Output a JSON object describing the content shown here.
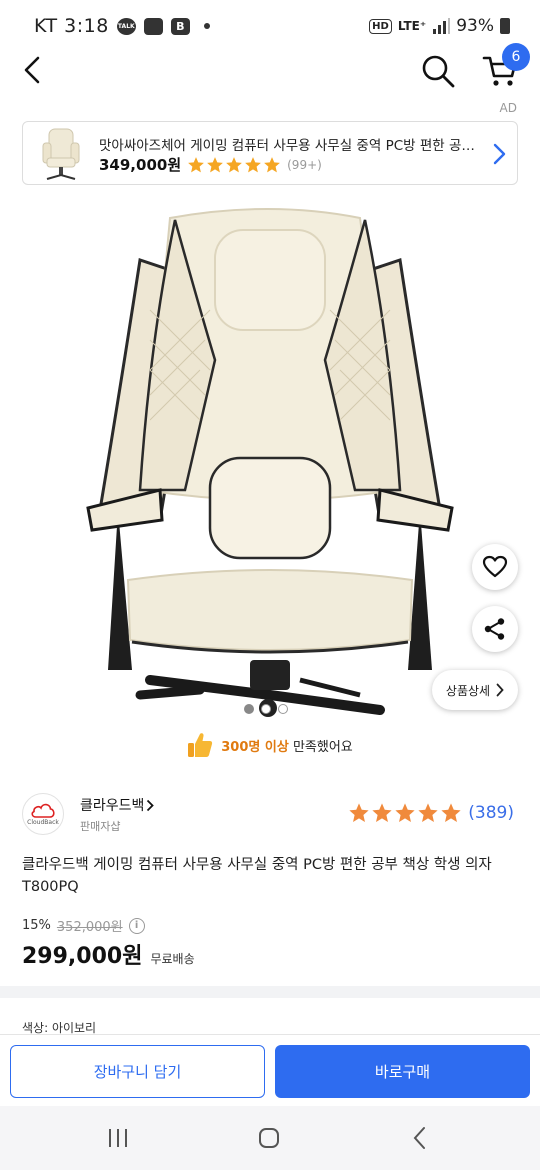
{
  "status_bar": {
    "carrier_time": "KT 3:18",
    "talk_icon": "TALK",
    "network": "LTE⁺",
    "battery": "93%"
  },
  "header": {
    "cart_count": "6"
  },
  "ad": {
    "tag": "AD",
    "title": "맛아싸아즈체어 게이밍 컴퓨터 사무용 사무실 중역 PC방 편한 공부 ...",
    "price": "349,000원",
    "review_count": "(99+)"
  },
  "gallery": {
    "detail_label": "상품상세",
    "satisfaction_count": "300명 이상",
    "satisfaction_text": "만족했어요"
  },
  "seller": {
    "logo_text": "CloudBack",
    "name": "클라우드백",
    "type": "판매자샵",
    "rating_count": "(389)"
  },
  "product": {
    "title": "클라우드백 게이밍 컴퓨터 사무용 사무실 중역 PC방 편한 공부 책상 학생 의자 T800PQ",
    "discount_rate": "15%",
    "original_price": "352,000원",
    "price": "299,000원",
    "shipping": "무료배송",
    "option_label": "색상: 아이보리"
  },
  "actions": {
    "cart_label": "장바구니 담기",
    "buy_label": "바로구매"
  },
  "colors": {
    "accent": "#2e6cf0",
    "star": "#f5a623",
    "rating_link": "#3a6ee8"
  },
  "icons": [
    "back-icon",
    "search-icon",
    "cart-icon",
    "heart-icon",
    "share-icon",
    "chevron-right-icon",
    "thumbs-up-icon",
    "info-icon",
    "star-icon"
  ]
}
